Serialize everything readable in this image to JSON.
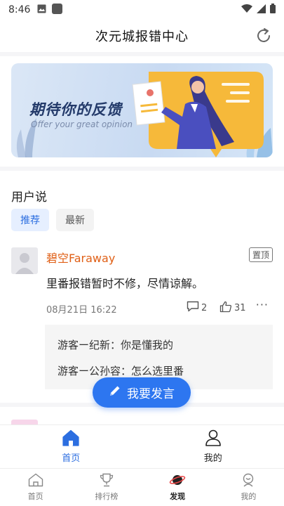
{
  "status_bar": {
    "time": "8:46",
    "icons": [
      "image-icon",
      "app-icon",
      "wifi-icon",
      "signal-icon",
      "battery-icon"
    ]
  },
  "header": {
    "title": "次元城报错中心",
    "refresh_icon": "refresh-icon"
  },
  "banner": {
    "title": "期待你的反馈",
    "subtitle": "Offer your great opinion"
  },
  "section": {
    "title": "用户说"
  },
  "tabs": [
    {
      "label": "推荐",
      "active": true
    },
    {
      "label": "最新",
      "active": false
    }
  ],
  "post": {
    "username": "碧空Faraway",
    "badge": "置顶",
    "body": "里番报错暂时不修，尽情谅解。",
    "time": "08月21日 16:22",
    "comments": "2",
    "likes": "31",
    "more": "···",
    "replies": [
      "游客ー纪新：你是懂我的",
      "游客ー公孙容：怎么选里番"
    ]
  },
  "fab": {
    "label": "我要发言"
  },
  "inner_tabbar": [
    {
      "label": "首页",
      "icon": "home-icon",
      "active": true
    },
    {
      "label": "我的",
      "icon": "person-icon",
      "active": false
    }
  ],
  "bottom_nav": [
    {
      "label": "首页",
      "icon": "home-icon",
      "active": false
    },
    {
      "label": "排行榜",
      "icon": "trophy-icon",
      "active": false
    },
    {
      "label": "发现",
      "icon": "planet-icon",
      "active": true
    },
    {
      "label": "我的",
      "icon": "profile-icon",
      "active": false
    }
  ],
  "colors": {
    "accent": "#2d76f0",
    "username": "#e06017",
    "banner_bg": "#c8daf2"
  }
}
